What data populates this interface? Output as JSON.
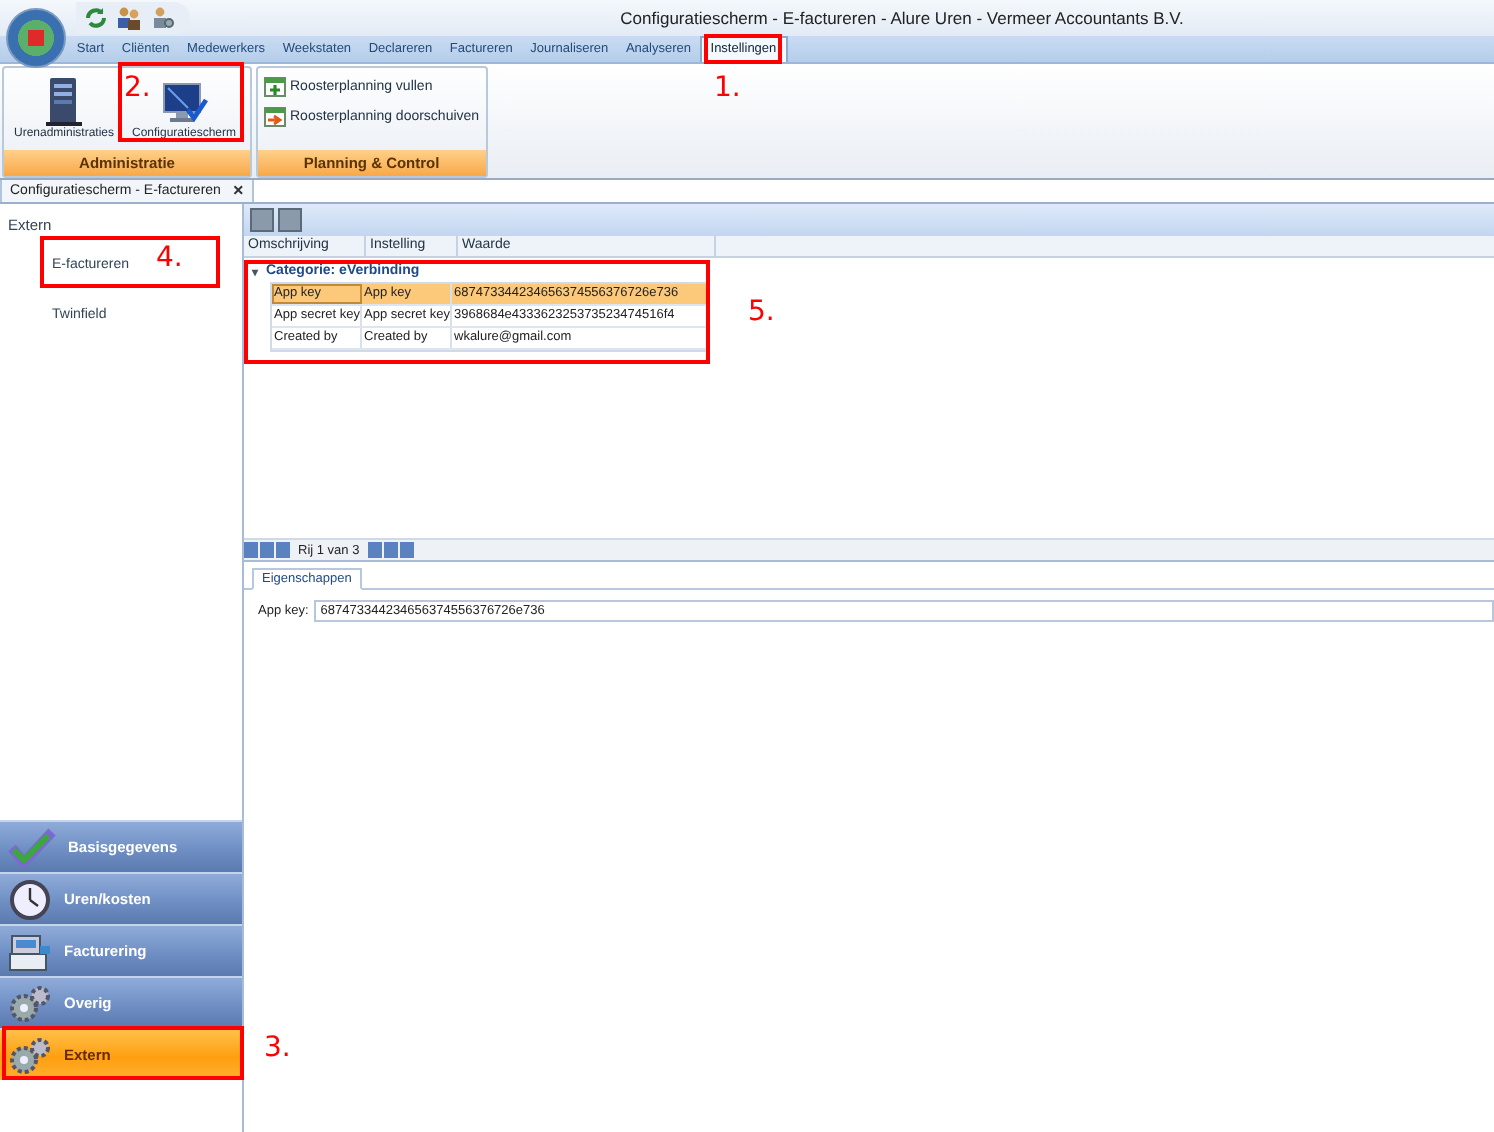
{
  "window": {
    "title": "Configuratiescherm - E-factureren - Alure Uren - Vermeer Accountants B.V."
  },
  "ribbon_tabs": [
    {
      "label": "Start",
      "selected": false
    },
    {
      "label": "Cliënten",
      "selected": false
    },
    {
      "label": "Medewerkers",
      "selected": false
    },
    {
      "label": "Weekstaten",
      "selected": false
    },
    {
      "label": "Declareren",
      "selected": false
    },
    {
      "label": "Factureren",
      "selected": false
    },
    {
      "label": "Journaliseren",
      "selected": false
    },
    {
      "label": "Analyseren",
      "selected": false
    },
    {
      "label": "Instellingen",
      "selected": true
    }
  ],
  "ribbon_groups": [
    {
      "label": "Administratie",
      "kind": "large",
      "buttons": [
        {
          "label": "Urenadministraties"
        },
        {
          "label": "Configuratiescherm"
        }
      ]
    },
    {
      "label": "Planning & Control",
      "kind": "small",
      "buttons": [
        {
          "label": "Roosterplanning vullen"
        },
        {
          "label": "Roosterplanning doorschuiven"
        }
      ]
    }
  ],
  "document_tabs": [
    {
      "label": "Configuratiescherm - E-factureren",
      "close": "×"
    }
  ],
  "left_panel": {
    "header": "Extern",
    "items": [
      {
        "label": "E-factureren"
      },
      {
        "label": "Twinfield"
      }
    ]
  },
  "nav_buttons": [
    {
      "label": "Basisgegevens",
      "selected": false
    },
    {
      "label": "Uren/kosten",
      "selected": false
    },
    {
      "label": "Facturering",
      "selected": false
    },
    {
      "label": "Overig",
      "selected": false
    },
    {
      "label": "Extern",
      "selected": true
    }
  ],
  "grid": {
    "columns": [
      "Omschrijving",
      "Instelling",
      "Waarde"
    ],
    "group_toggle": "▾",
    "group": "Categorie: eVerbinding",
    "rows": [
      {
        "cells": [
          "App key",
          "App key",
          "687473344234656374556376726e736"
        ],
        "selected": true
      },
      {
        "cells": [
          "App secret key",
          "App secret key",
          "3968684e433362325373523474516f4"
        ],
        "selected": false
      },
      {
        "cells": [
          "Created by",
          "Created by",
          "wkalure@gmail.com"
        ],
        "selected": false
      }
    ]
  },
  "pager": {
    "text": "Rij 1 van 3"
  },
  "details": {
    "tabs": [
      {
        "label": "Eigenschappen",
        "selected": true
      }
    ],
    "fields": [
      {
        "label": "App key:",
        "value": "687473344234656374556376726e736"
      }
    ]
  },
  "annotations": [
    {
      "label": "1."
    },
    {
      "label": "2."
    },
    {
      "label": "3."
    },
    {
      "label": "4."
    },
    {
      "label": "5."
    }
  ]
}
